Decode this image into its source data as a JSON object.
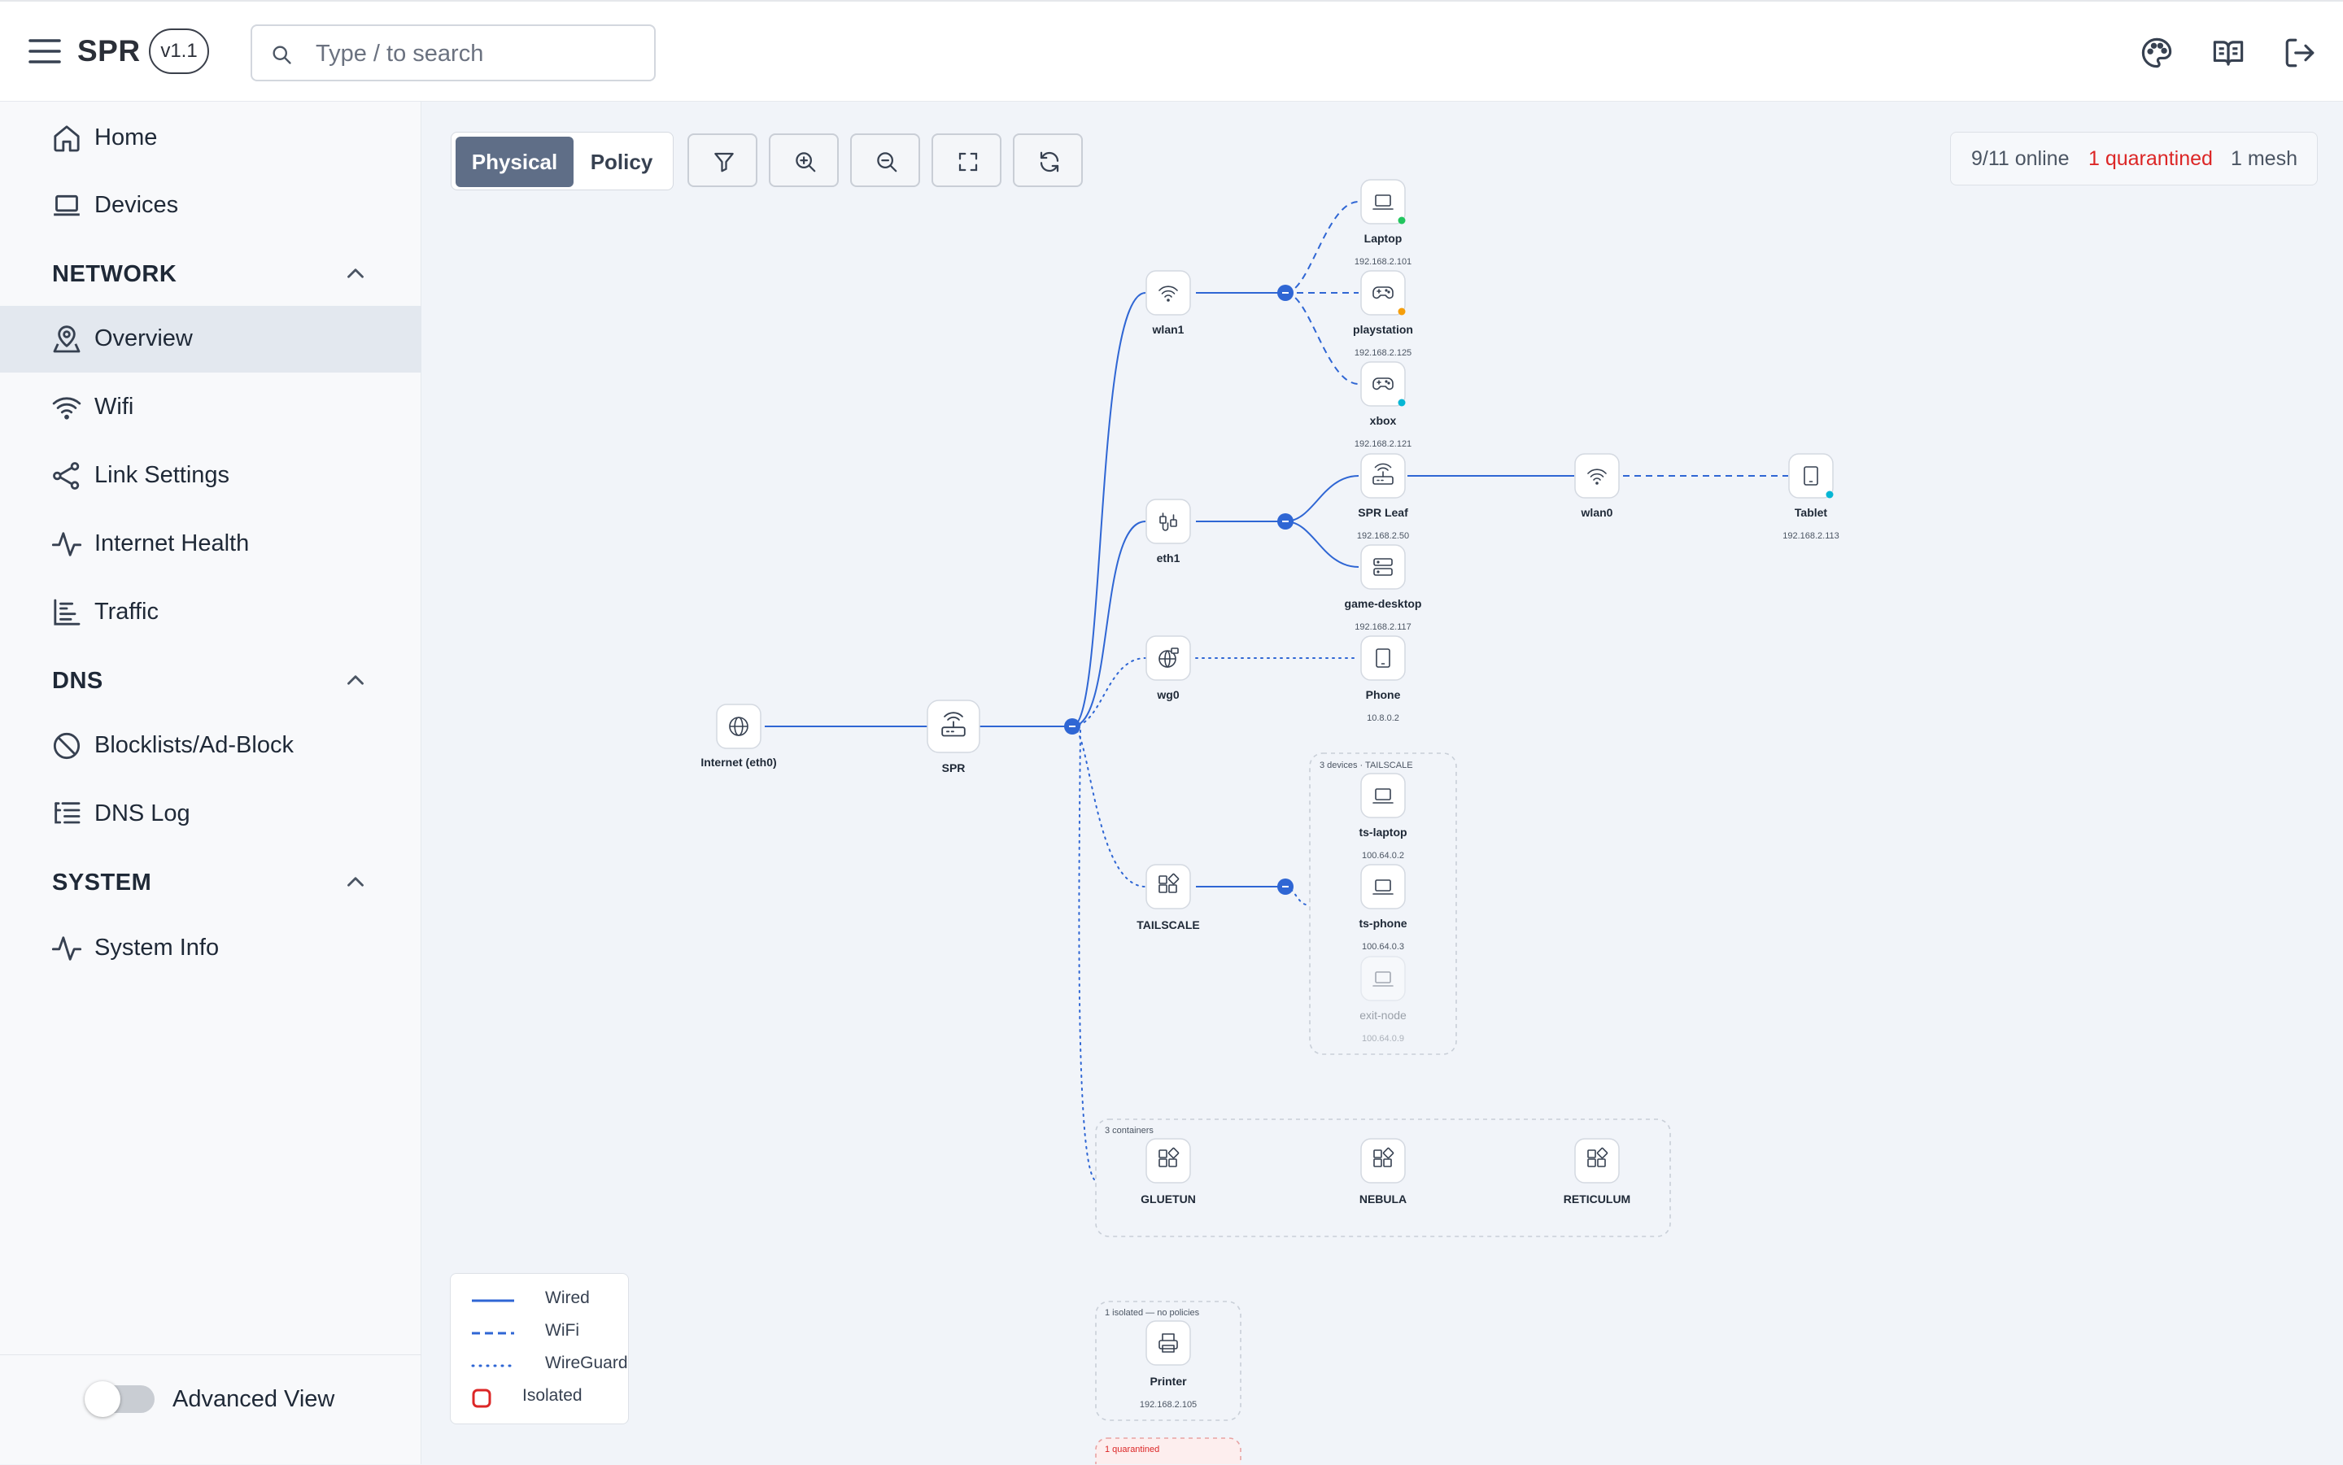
{
  "app": {
    "name": "SPR",
    "version": "v1.1"
  },
  "search": {
    "placeholder": "Type / to search"
  },
  "header_icons": [
    "palette-icon",
    "book-icon",
    "logout-icon"
  ],
  "sidebar": {
    "top_items": [
      {
        "label": "Home",
        "icon": "home-icon"
      },
      {
        "label": "Devices",
        "icon": "laptop-icon"
      }
    ],
    "sections": [
      {
        "title": "NETWORK",
        "items": [
          {
            "label": "Overview",
            "icon": "map-pin-icon",
            "active": true
          },
          {
            "label": "Wifi",
            "icon": "wifi-icon"
          },
          {
            "label": "Link Settings",
            "icon": "link-icon"
          },
          {
            "label": "Internet Health",
            "icon": "activity-icon"
          },
          {
            "label": "Traffic",
            "icon": "chart-icon"
          }
        ]
      },
      {
        "title": "DNS",
        "items": [
          {
            "label": "Blocklists/Ad-Block",
            "icon": "block-icon"
          },
          {
            "label": "DNS Log",
            "icon": "list-tree-icon"
          }
        ]
      },
      {
        "title": "SYSTEM",
        "items": [
          {
            "label": "System Info",
            "icon": "activity-icon"
          }
        ]
      }
    ],
    "advanced_view": {
      "label": "Advanced View",
      "enabled": false
    }
  },
  "toolbar": {
    "views": [
      "Physical",
      "Policy"
    ],
    "active_view": "Physical",
    "tools": [
      "filter-icon",
      "zoom-in-icon",
      "zoom-out-icon",
      "fit-view-icon",
      "refresh-icon"
    ]
  },
  "status": {
    "online": "9/11 online",
    "quarantined": "1 quarantined",
    "mesh": "1 mesh"
  },
  "topology": {
    "nodes": [
      {
        "id": "internet",
        "label": "Internet (eth0)",
        "icon": "globe-icon"
      },
      {
        "id": "spr",
        "label": "SPR",
        "icon": "router-icon"
      },
      {
        "id": "wlan1",
        "label": "wlan1",
        "icon": "wifi-icon"
      },
      {
        "id": "eth1",
        "label": "eth1",
        "icon": "ethernet-icon"
      },
      {
        "id": "wg0",
        "label": "wg0",
        "icon": "globe-lock-icon"
      },
      {
        "id": "tailscale",
        "label": "TAILSCALE",
        "icon": "container-icon"
      },
      {
        "id": "laptop",
        "label": "Laptop",
        "ip": "192.168.2.101",
        "icon": "laptop-icon",
        "status": "green"
      },
      {
        "id": "playstation",
        "label": "playstation",
        "ip": "192.168.2.125",
        "icon": "gamepad-icon",
        "status": "orange"
      },
      {
        "id": "xbox",
        "label": "xbox",
        "ip": "192.168.2.121",
        "icon": "gamepad-icon",
        "status": "cyan"
      },
      {
        "id": "sprleaf",
        "label": "SPR Leaf",
        "ip": "192.168.2.50",
        "icon": "router-icon"
      },
      {
        "id": "gamedesktop",
        "label": "game-desktop",
        "ip": "192.168.2.117",
        "icon": "server-icon"
      },
      {
        "id": "wlan0",
        "label": "wlan0",
        "icon": "wifi-icon"
      },
      {
        "id": "tablet",
        "label": "Tablet",
        "ip": "192.168.2.113",
        "icon": "tablet-icon",
        "status": "cyan"
      },
      {
        "id": "phone",
        "label": "Phone",
        "ip": "10.8.0.2",
        "icon": "tablet-icon"
      },
      {
        "id": "tslaptop",
        "label": "ts-laptop",
        "ip": "100.64.0.2",
        "icon": "laptop-icon"
      },
      {
        "id": "tsphone",
        "label": "ts-phone",
        "ip": "100.64.0.3",
        "icon": "laptop-icon"
      },
      {
        "id": "exitnode",
        "label": "exit-node",
        "ip": "100.64.0.9",
        "icon": "laptop-icon",
        "faded": true
      },
      {
        "id": "gluetun",
        "label": "GLUETUN",
        "icon": "container-icon"
      },
      {
        "id": "nebula",
        "label": "NEBULA",
        "icon": "container-icon"
      },
      {
        "id": "reticulum",
        "label": "RETICULUM",
        "icon": "container-icon"
      },
      {
        "id": "printer",
        "label": "Printer",
        "ip": "192.168.2.105",
        "icon": "printer-icon"
      }
    ],
    "groups": {
      "tailscale": "3 devices · TAILSCALE",
      "containers": "3 containers",
      "isolated": "1 isolated — no policies",
      "quarantined": "1 quarantined"
    }
  },
  "legend": {
    "items": [
      {
        "label": "Wired",
        "style": "solid"
      },
      {
        "label": "WiFi",
        "style": "dashed"
      },
      {
        "label": "WireGuard",
        "style": "dotted"
      },
      {
        "label": "Isolated",
        "style": "box"
      }
    ]
  },
  "colors": {
    "link": "#2f66d4",
    "active_nav": "#e3e8ef",
    "quarantine": "#dc2626",
    "view_active": "#5f6e87"
  }
}
